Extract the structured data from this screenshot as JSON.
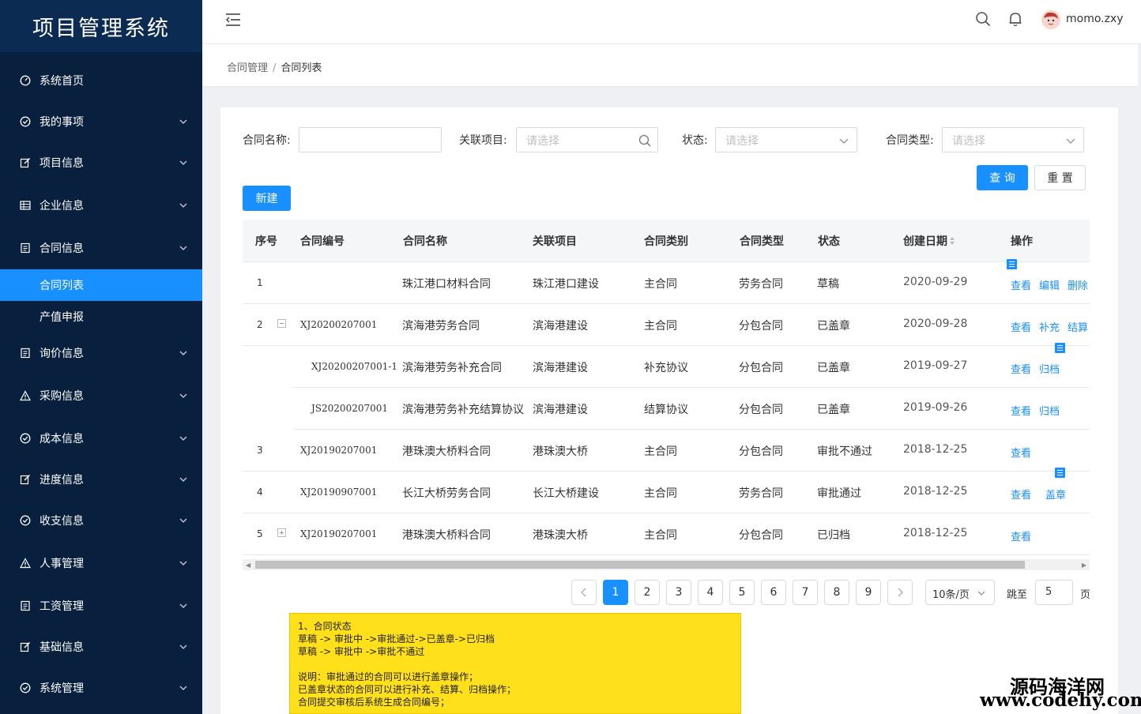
{
  "app": {
    "title": "项目管理系统"
  },
  "sidebar": {
    "items": [
      {
        "label": "系统首页",
        "icon": "dashboard-icon",
        "expandable": false
      },
      {
        "label": "我的事项",
        "icon": "check-circle-icon",
        "expandable": true
      },
      {
        "label": "项目信息",
        "icon": "edit-icon",
        "expandable": true
      },
      {
        "label": "企业信息",
        "icon": "table-icon",
        "expandable": true
      },
      {
        "label": "合同信息",
        "icon": "document-icon",
        "expandable": true,
        "expanded": true
      },
      {
        "label": "询价信息",
        "icon": "document-icon",
        "expandable": true
      },
      {
        "label": "采购信息",
        "icon": "warning-icon",
        "expandable": true
      },
      {
        "label": "成本信息",
        "icon": "check-circle-icon",
        "expandable": true
      },
      {
        "label": "进度信息",
        "icon": "edit-icon",
        "expandable": true
      },
      {
        "label": "收支信息",
        "icon": "check-circle-icon",
        "expandable": true
      },
      {
        "label": "人事管理",
        "icon": "warning-icon",
        "expandable": true
      },
      {
        "label": "工资管理",
        "icon": "document-icon",
        "expandable": true
      },
      {
        "label": "基础信息",
        "icon": "edit-icon",
        "expandable": true
      },
      {
        "label": "系统管理",
        "icon": "check-circle-icon",
        "expandable": true
      }
    ],
    "subitems": [
      {
        "label": "合同列表",
        "active": true
      },
      {
        "label": "产值申报",
        "active": false
      }
    ]
  },
  "header": {
    "username": "momo.zxy"
  },
  "breadcrumb": {
    "parent": "合同管理",
    "separator": "/",
    "current": "合同列表"
  },
  "filters": {
    "name_label": "合同名称:",
    "name_value": "",
    "project_label": "关联项目:",
    "project_placeholder": "请选择",
    "status_label": "状态:",
    "status_placeholder": "请选择",
    "type_label": "合同类型:",
    "type_placeholder": "请选择",
    "query_button": "查 询",
    "reset_button": "重 置",
    "new_button": "新建"
  },
  "table": {
    "headers": [
      "序号",
      "合同编号",
      "合同名称",
      "关联项目",
      "合同类别",
      "合同类型",
      "状态",
      "创建日期",
      "操作"
    ],
    "rows": [
      {
        "seq": "1",
        "code": "",
        "name": "珠江港口材料合同",
        "project": "珠江港口建设",
        "category": "主合同",
        "type": "劳务合同",
        "status": "草稿",
        "date": "2020-09-29",
        "actions": [
          "查看",
          "编辑",
          "删除"
        ]
      },
      {
        "seq": "2",
        "code": "XJ20200207001",
        "name": "滨海港劳务合同",
        "project": "滨海港建设",
        "category": "主合同",
        "type": "分包合同",
        "status": "已盖章",
        "date": "2020-09-28",
        "actions": [
          "查看",
          "补充",
          "结算"
        ]
      },
      {
        "seq": "",
        "code": "XJ20200207001-1",
        "name": "滨海港劳务补充合同",
        "project": "滨海港建设",
        "category": "补充协议",
        "type": "分包合同",
        "status": "已盖章",
        "date": "2019-09-27",
        "actions": [
          "查看",
          "归档"
        ]
      },
      {
        "seq": "",
        "code": "JS20200207001",
        "name": "滨海港劳务补充结算协议",
        "project": "滨海港建设",
        "category": "结算协议",
        "type": "分包合同",
        "status": "已盖章",
        "date": "2019-09-26",
        "actions": [
          "查看",
          "归档"
        ]
      },
      {
        "seq": "3",
        "code": "XJ20190207001",
        "name": "港珠澳大桥料合同",
        "project": "港珠澳大桥",
        "category": "主合同",
        "type": "分包合同",
        "status": "审批不通过",
        "date": "2018-12-25",
        "actions": [
          "查看"
        ]
      },
      {
        "seq": "4",
        "code": "XJ20190907001",
        "name": "长江大桥劳务合同",
        "project": "长江大桥建设",
        "category": "主合同",
        "type": "劳务合同",
        "status": "审批通过",
        "date": "2018-12-25",
        "actions": [
          "查看",
          "盖章"
        ]
      },
      {
        "seq": "5",
        "code": "XJ20190207001",
        "name": "港珠澳大桥料合同",
        "project": "港珠澳大桥",
        "category": "主合同",
        "type": "分包合同",
        "status": "已归档",
        "date": "2018-12-25",
        "actions": [
          "查看"
        ]
      }
    ]
  },
  "pagination": {
    "pages": [
      "1",
      "2",
      "3",
      "4",
      "5",
      "6",
      "7",
      "8",
      "9"
    ],
    "current": "1",
    "page_size": "10条/页",
    "jump_label": "跳至",
    "jump_value": "5",
    "page_suffix": "页"
  },
  "note": {
    "lines": [
      "1、合同状态",
      "草稿 -> 审批中 ->审批通过->已盖章->已归档",
      "草稿 -> 审批中 ->审批不通过",
      "",
      "说明：审批通过的合同可以进行盖章操作；",
      "已盖章状态的合同可以进行补充、结算、归档操作；",
      "合同提交审核后系统生成合同编号；"
    ]
  },
  "watermark": {
    "line1": "源码海洋网",
    "line2": "www.codehy.com"
  },
  "colors": {
    "sidebar_bg": "#08203d",
    "logo_bg": "#0c2b52",
    "accent": "#1890ff",
    "note_bg": "#ffe01a"
  }
}
